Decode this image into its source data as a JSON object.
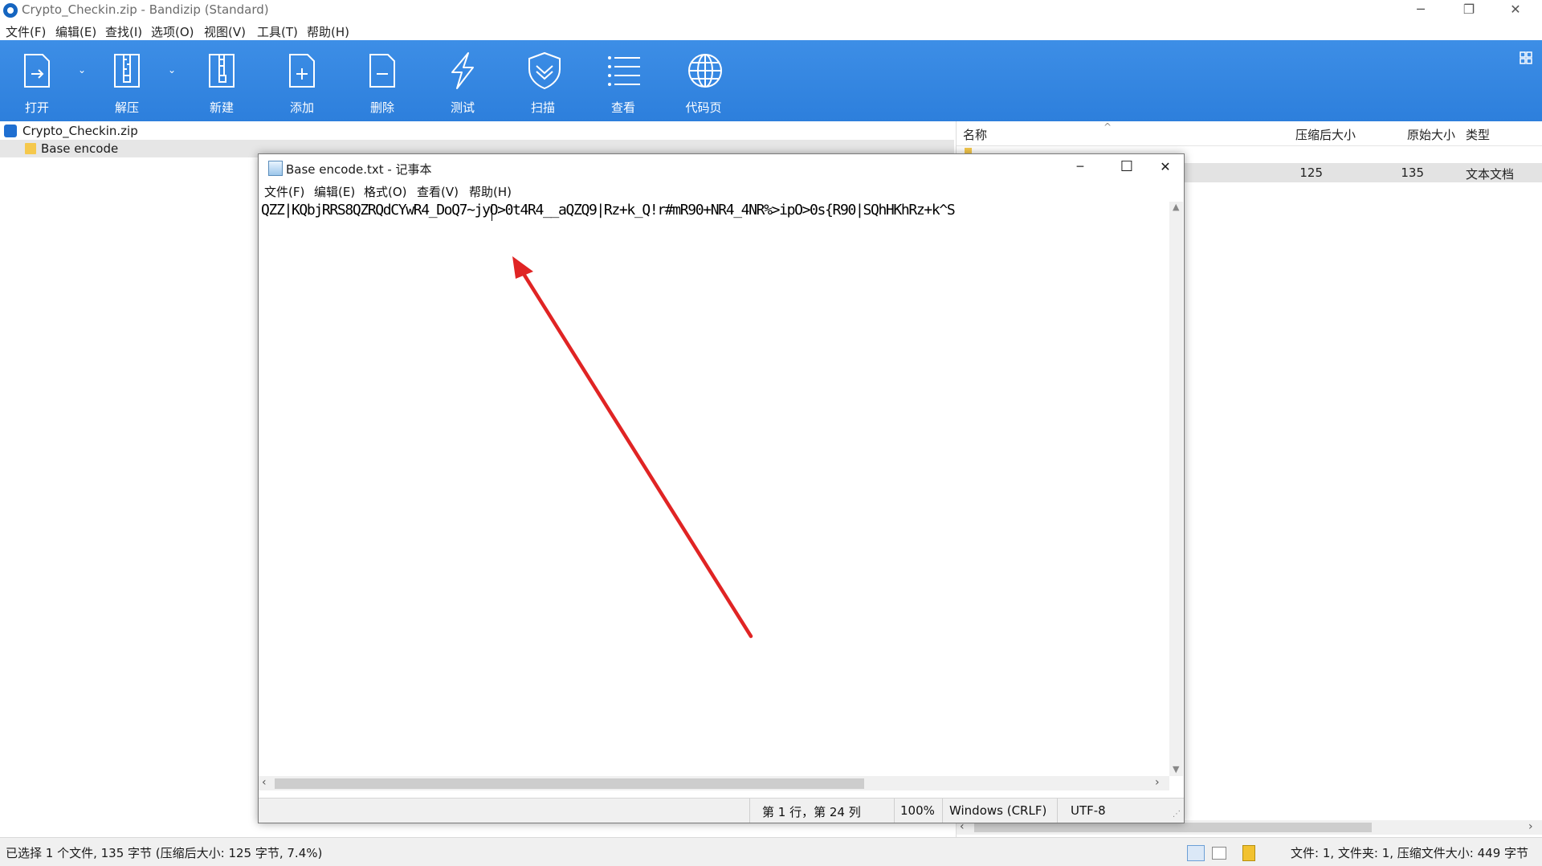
{
  "bandizip": {
    "title": "Crypto_Checkin.zip - Bandizip (Standard)",
    "window_controls": {
      "minimize": "─",
      "restore": "❐",
      "close": "✕"
    },
    "menu": [
      "文件(F)",
      "编辑(E)",
      "查找(I)",
      "选项(O)",
      "视图(V)",
      "工具(T)",
      "帮助(H)"
    ],
    "toolbar": [
      {
        "label": "打开",
        "icon": "open-icon"
      },
      {
        "label": "解压",
        "icon": "extract-icon"
      },
      {
        "label": "新建",
        "icon": "new-archive-icon"
      },
      {
        "label": "添加",
        "icon": "add-file-icon"
      },
      {
        "label": "删除",
        "icon": "delete-file-icon"
      },
      {
        "label": "测试",
        "icon": "test-icon"
      },
      {
        "label": "扫描",
        "icon": "scan-shield-icon"
      },
      {
        "label": "查看",
        "icon": "view-list-icon"
      },
      {
        "label": "代码页",
        "icon": "globe-icon"
      }
    ],
    "tree": {
      "root": "Crypto_Checkin.zip",
      "child": "Base encode"
    },
    "list": {
      "headers": {
        "name": "名称",
        "compressed": "压缩后大小",
        "original": "原始大小",
        "type": "类型"
      },
      "row": {
        "compressed": "125",
        "original": "135",
        "type": "文本文档"
      }
    },
    "status_left": "已选择 1 个文件, 135 字节 (压缩后大小: 125 字节, 7.4%)",
    "status_right": "文件: 1, 文件夹: 1, 压缩文件大小: 449 字节"
  },
  "notepad": {
    "title": "Base encode.txt - 记事本",
    "window_controls": {
      "minimize": "─",
      "maximize": "☐",
      "close": "✕"
    },
    "menu": [
      "文件(F)",
      "编辑(E)",
      "格式(O)",
      "查看(V)",
      "帮助(H)"
    ],
    "content": "QZZ|KQbjRRS8QZRQdCYwR4_DoQ7~jyO>0t4R4__aQZQ9|Rz+k_Q!r#mR90+NR4_4NR%>ipO>0s{R90|SQhHKhRz+k^S",
    "status": {
      "position": "第 1 行，第 24 列",
      "zoom": "100%",
      "line_ending": "Windows (CRLF)",
      "encoding": "UTF-8"
    }
  },
  "colors": {
    "toolbar_blue": "#2d7fdc",
    "arrow_red": "#e02424"
  }
}
